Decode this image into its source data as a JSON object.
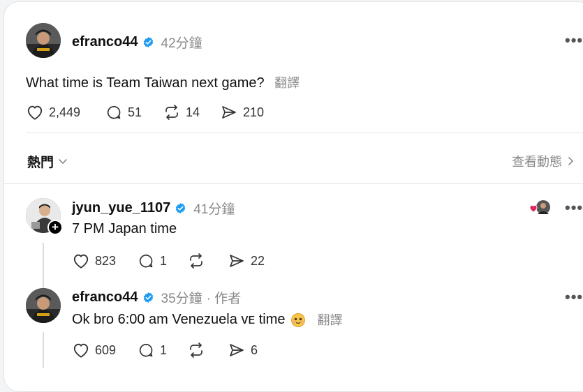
{
  "post": {
    "username": "efranco44",
    "time": "42分鐘",
    "text": "What time is Team Taiwan next game?",
    "translate": "翻譯",
    "likes": "2,449",
    "comments": "51",
    "reposts": "14",
    "shares": "210"
  },
  "sort": {
    "label": "熱門",
    "view_activity": "查看動態"
  },
  "replies": [
    {
      "username": "jyun_yue_1107",
      "time": "41分鐘",
      "text": "7 PM Japan time",
      "likes": "823",
      "comments": "1",
      "reposts": "",
      "shares": "22"
    },
    {
      "username": "efranco44",
      "time": "35分鐘",
      "author_tag": "· 作者",
      "text": "Ok bro 6:00 am Venezuela ᴠᴇ time",
      "translate": "翻譯",
      "likes": "609",
      "comments": "1",
      "reposts": "",
      "shares": "6"
    }
  ],
  "icons": {
    "more": "more-horizontal-icon",
    "like": "heart-icon",
    "comment": "comment-bubble-icon",
    "repost": "repost-icon",
    "share": "send-icon",
    "verified": "verified-badge-icon",
    "chevron": "chevron-down-icon"
  },
  "colors": {
    "verified": "#1d9bf0",
    "meta": "#8a8a8a",
    "heart_badge": "#e0245e"
  }
}
